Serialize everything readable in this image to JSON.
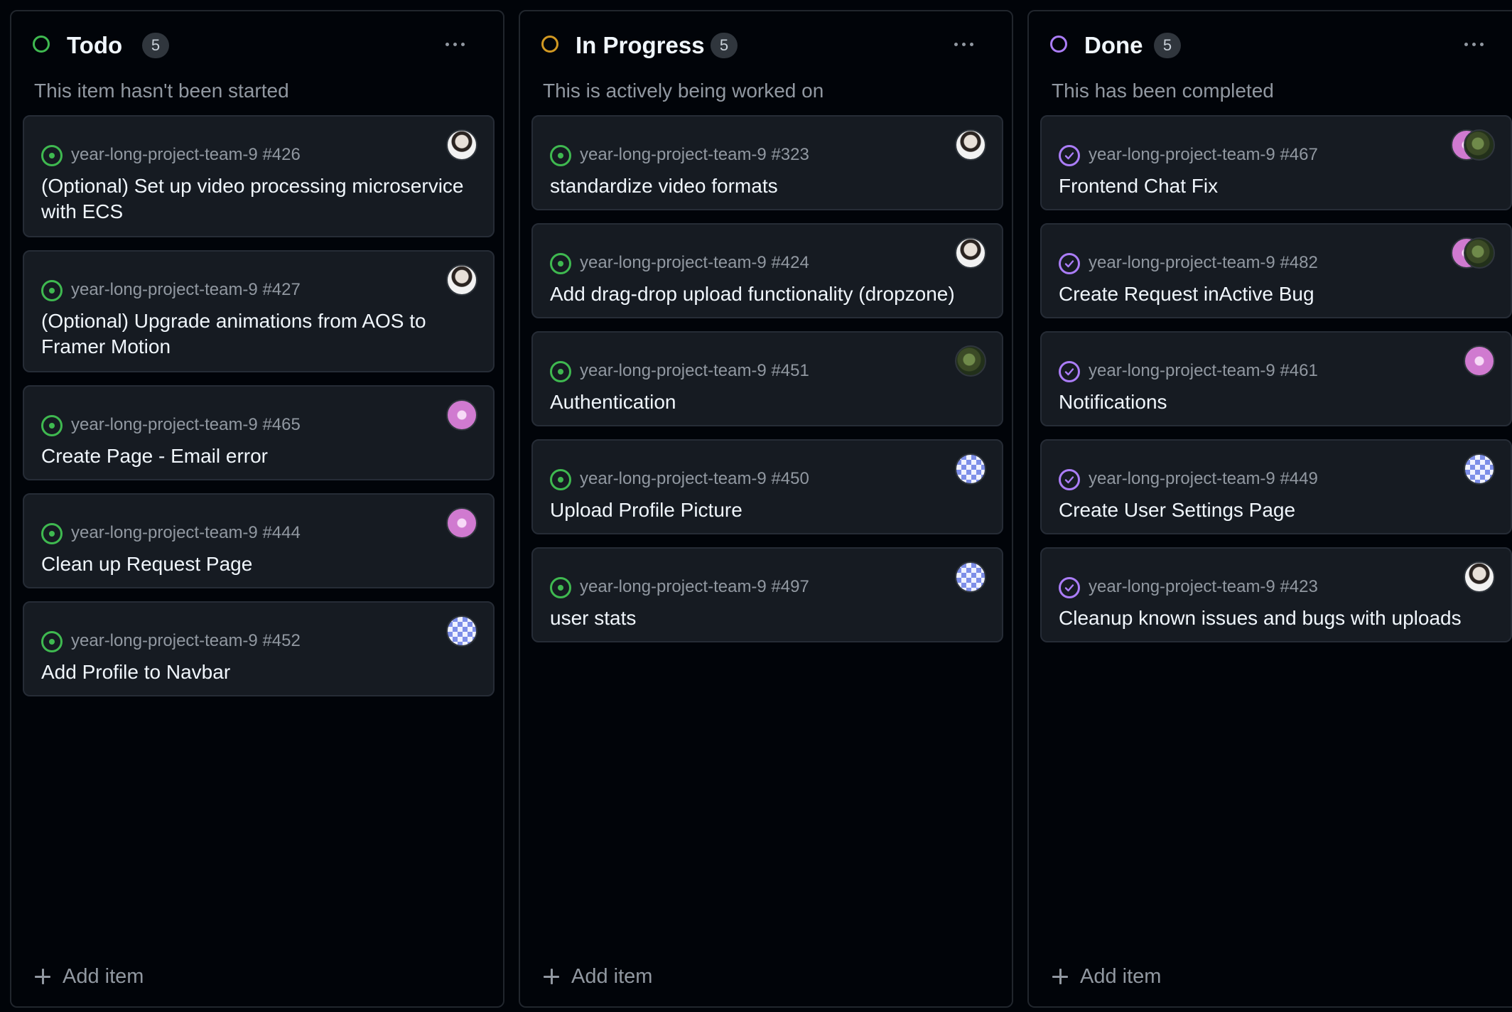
{
  "colors": {
    "todo": "#3fb950",
    "in_progress": "#d29922",
    "done": "#ab7df8",
    "open_issue": "#3fb950",
    "closed_issue": "#ab7df8"
  },
  "columns": [
    {
      "title": "Todo",
      "count": "5",
      "description": "This item hasn't been started",
      "add_label": "Add item",
      "cards": [
        {
          "repo": "year-long-project-team-9 #426",
          "title": "(Optional) Set up video processing microservice with ECS",
          "status_icon": "issue-open-icon",
          "avatar": "avatar-portrait"
        },
        {
          "repo": "year-long-project-team-9 #427",
          "title": "(Optional) Upgrade animations from AOS to Framer Motion",
          "status_icon": "issue-open-icon",
          "avatar": "avatar-portrait"
        },
        {
          "repo": "year-long-project-team-9 #465",
          "title": "Create Page - Email error",
          "status_icon": "issue-open-icon",
          "avatar": "avatar-pink"
        },
        {
          "repo": "year-long-project-team-9 #444",
          "title": "Clean up Request Page",
          "status_icon": "issue-open-icon",
          "avatar": "avatar-pink"
        },
        {
          "repo": "year-long-project-team-9 #452",
          "title": "Add Profile to Navbar",
          "status_icon": "issue-open-icon",
          "avatar": "avatar-checker"
        }
      ]
    },
    {
      "title": "In Progress",
      "count": "5",
      "description": "This is actively being worked on",
      "add_label": "Add item",
      "cards": [
        {
          "repo": "year-long-project-team-9 #323",
          "title": "standardize video formats",
          "status_icon": "issue-open-icon",
          "avatar": "avatar-portrait"
        },
        {
          "repo": "year-long-project-team-9 #424",
          "title": "Add drag-drop upload functionality (dropzone)",
          "status_icon": "issue-open-icon",
          "avatar": "avatar-portrait"
        },
        {
          "repo": "year-long-project-team-9 #451",
          "title": "Authentication",
          "status_icon": "issue-open-icon",
          "avatar": "avatar-green"
        },
        {
          "repo": "year-long-project-team-9 #450",
          "title": "Upload Profile Picture",
          "status_icon": "issue-open-icon",
          "avatar": "avatar-checker"
        },
        {
          "repo": "year-long-project-team-9 #497",
          "title": "user stats",
          "status_icon": "issue-open-icon",
          "avatar": "avatar-checker"
        }
      ]
    },
    {
      "title": "Done",
      "count": "5",
      "description": "This has been completed",
      "add_label": "Add item",
      "cards": [
        {
          "repo": "year-long-project-team-9 #467",
          "title": "Frontend Chat Fix",
          "status_icon": "issue-closed-icon",
          "avatar": "avatar-pair"
        },
        {
          "repo": "year-long-project-team-9 #482",
          "title": "Create Request inActive Bug",
          "status_icon": "issue-closed-icon",
          "avatar": "avatar-pair"
        },
        {
          "repo": "year-long-project-team-9 #461",
          "title": "Notifications",
          "status_icon": "issue-closed-icon",
          "avatar": "avatar-pink"
        },
        {
          "repo": "year-long-project-team-9 #449",
          "title": "Create User Settings Page",
          "status_icon": "issue-closed-icon",
          "avatar": "avatar-checker"
        },
        {
          "repo": "year-long-project-team-9 #423",
          "title": "Cleanup known issues and bugs with uploads",
          "status_icon": "issue-closed-icon",
          "avatar": "avatar-portrait"
        }
      ]
    }
  ]
}
